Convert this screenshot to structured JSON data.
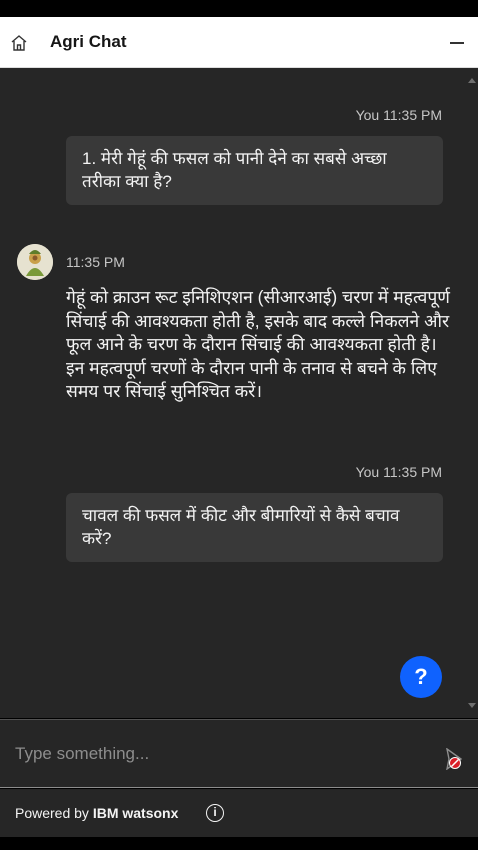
{
  "header": {
    "title": "Agri Chat"
  },
  "messages": [
    {
      "role": "user",
      "meta": "You 11:35 PM",
      "text": "1. मेरी गेहूं की फसल को पानी देने का सबसे अच्छा तरीका क्या है?"
    },
    {
      "role": "bot",
      "time": "11:35 PM",
      "text": "गेहूं को क्राउन रूट इनिशिएशन (सीआरआई) चरण में महत्वपूर्ण सिंचाई की आवश्यकता होती है, इसके बाद कल्ले निकलने और फूल आने के चरण के दौरान सिंचाई की आवश्यकता होती है। इन महत्वपूर्ण चरणों के दौरान पानी के तनाव से बचने के लिए समय पर सिंचाई सुनिश्चित करें।"
    },
    {
      "role": "user",
      "meta": "You 11:35 PM",
      "text": "चावल की फसल में कीट और बीमारियों से कैसे बचाव करें?"
    }
  ],
  "help_button": {
    "label": "?"
  },
  "input": {
    "placeholder": "Type something..."
  },
  "footer": {
    "powered_prefix": "Powered by",
    "powered_brand": "IBM watsonx",
    "info_symbol": "i"
  },
  "colors": {
    "accent": "#0f62fe",
    "panel": "#262626",
    "bubble": "#393939"
  },
  "icons": [
    "home-icon",
    "minimize-icon",
    "bot-avatar-icon",
    "help-icon",
    "send-icon",
    "info-icon"
  ]
}
